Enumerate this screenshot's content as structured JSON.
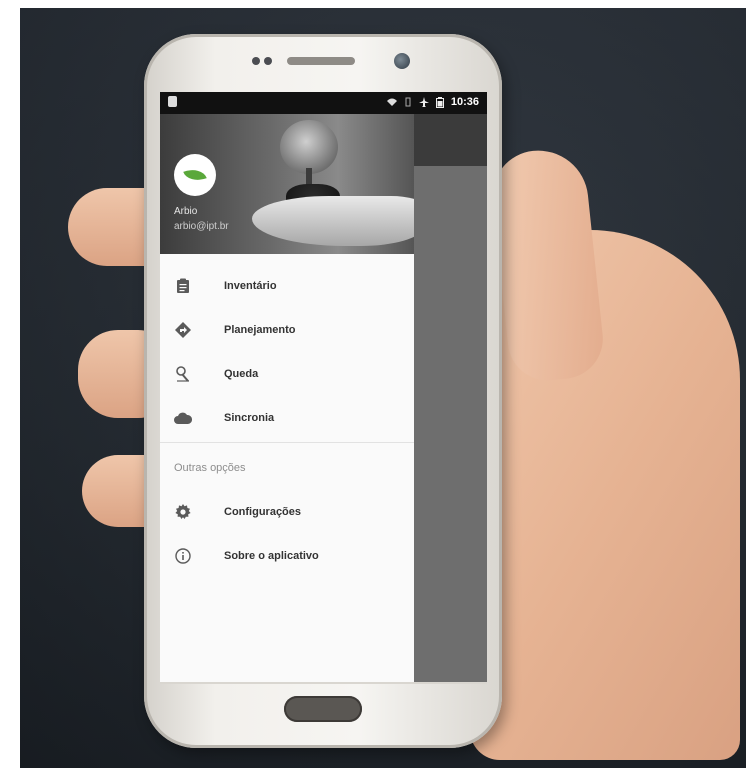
{
  "status_bar": {
    "time": "10:36",
    "icons": [
      "wifi-icon",
      "vibrate-icon",
      "airplane-icon",
      "battery-icon"
    ]
  },
  "drawer": {
    "user": {
      "name": "Arbio",
      "email": "arbio@ipt.br"
    },
    "menu_items": [
      {
        "label": "Inventário",
        "icon": "clipboard-icon"
      },
      {
        "label": "Planejamento",
        "icon": "directions-icon"
      },
      {
        "label": "Queda",
        "icon": "tree-fall-icon"
      },
      {
        "label": "Sincronia",
        "icon": "cloud-icon"
      }
    ],
    "other_section_title": "Outras opções",
    "other_items": [
      {
        "label": "Configurações",
        "icon": "gear-icon"
      },
      {
        "label": "Sobre o aplicativo",
        "icon": "info-icon"
      }
    ]
  },
  "colors": {
    "drawer_bg": "#fafafa",
    "screen_dim": "#6e6e6e",
    "statusbar_bg": "#111111",
    "label_text": "#333333",
    "section_title": "#8d8d8d"
  }
}
